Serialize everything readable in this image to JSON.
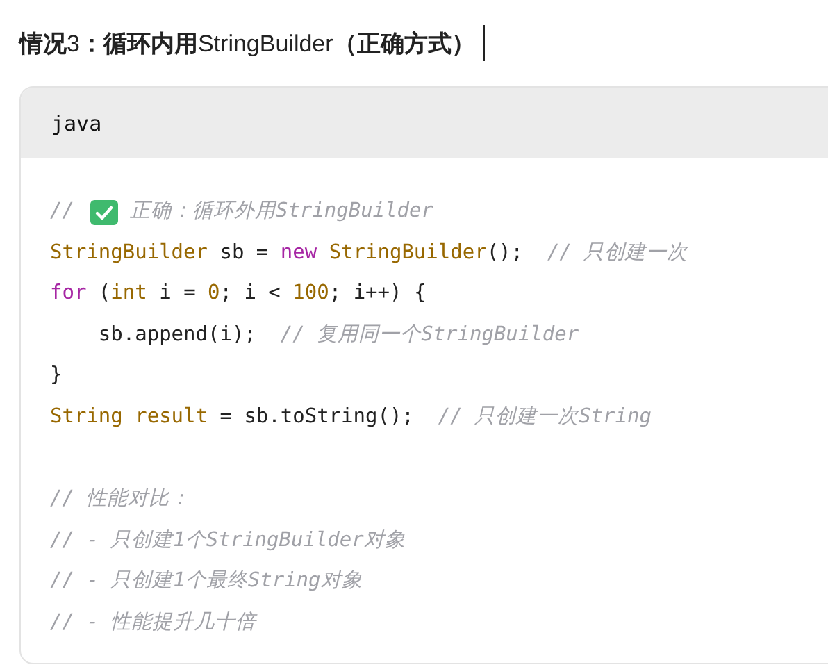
{
  "heading": {
    "text": "**情况**3**：循环内用**StringBuilder**（正确方式）**",
    "cursor": true
  },
  "code_block": {
    "language": "java",
    "lines": [
      [
        {
          "kind": "comment",
          "text": "//"
        },
        {
          "kind": "check"
        },
        {
          "kind": "comment",
          "text": "正确：循环外用StringBuilder"
        }
      ],
      [
        {
          "kind": "type",
          "text": "StringBuilder"
        },
        {
          "kind": "plain",
          "text": " sb = "
        },
        {
          "kind": "keyword",
          "text": "new"
        },
        {
          "kind": "type",
          "text": " StringBuilder"
        },
        {
          "kind": "plain",
          "text": "();  "
        },
        {
          "kind": "comment",
          "text": "// 只创建一次"
        }
      ],
      [
        {
          "kind": "keyword",
          "text": "for"
        },
        {
          "kind": "plain",
          "text": " ("
        },
        {
          "kind": "type",
          "text": "int"
        },
        {
          "kind": "plain",
          "text": " i = "
        },
        {
          "kind": "number",
          "text": "0"
        },
        {
          "kind": "plain",
          "text": "; i < "
        },
        {
          "kind": "number",
          "text": "100"
        },
        {
          "kind": "plain",
          "text": "; i++) {"
        }
      ],
      [
        {
          "kind": "plain",
          "text": "    sb.append(i);  "
        },
        {
          "kind": "comment",
          "text": "// 复用同一个StringBuilder"
        }
      ],
      [
        {
          "kind": "plain",
          "text": "}"
        }
      ],
      [
        {
          "kind": "type",
          "text": "String result"
        },
        {
          "kind": "plain",
          "text": " = sb.toString();  "
        },
        {
          "kind": "comment",
          "text": "// 只创建一次String"
        }
      ],
      [
        {
          "kind": "blank"
        }
      ],
      [
        {
          "kind": "comment",
          "text": "// 性能对比："
        }
      ],
      [
        {
          "kind": "comment",
          "text": "// - 只创建1个StringBuilder对象"
        }
      ],
      [
        {
          "kind": "comment",
          "text": "// - 只创建1个最终String对象"
        }
      ],
      [
        {
          "kind": "comment",
          "text": "// - 性能提升几十倍"
        }
      ]
    ]
  }
}
